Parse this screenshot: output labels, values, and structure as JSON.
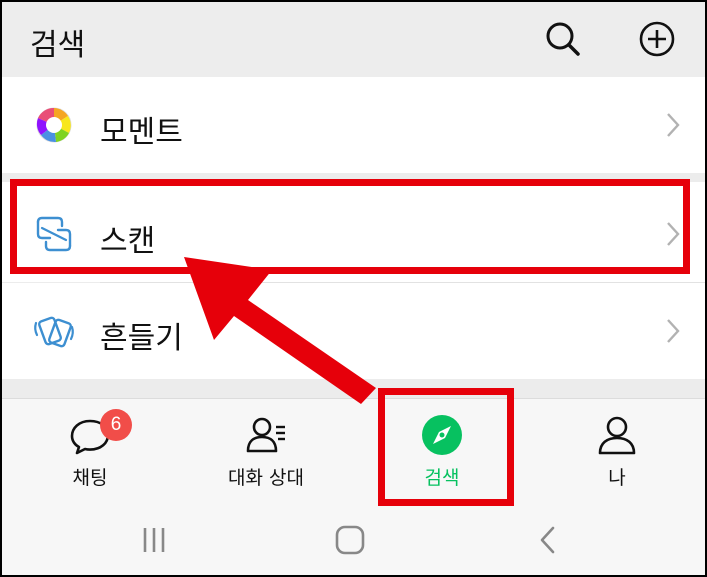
{
  "header": {
    "title": "검색",
    "search_icon": "search-icon",
    "add_icon": "plus-circle-icon"
  },
  "menu": {
    "items": [
      {
        "label": "모멘트",
        "icon": "moments-aperture-icon"
      },
      {
        "label": "스캔",
        "icon": "scan-icon"
      },
      {
        "label": "흔들기",
        "icon": "shake-icon"
      }
    ]
  },
  "tabbar": {
    "tabs": [
      {
        "label": "채팅",
        "icon": "chat-bubble-icon",
        "badge": "6"
      },
      {
        "label": "대화 상대",
        "icon": "contacts-icon"
      },
      {
        "label": "검색",
        "icon": "compass-icon",
        "active": true
      },
      {
        "label": "나",
        "icon": "person-icon"
      }
    ]
  },
  "colors": {
    "active_tab": "#07c160",
    "badge": "#f14d49",
    "highlight": "#e6000a",
    "header_bg": "#ededed"
  }
}
